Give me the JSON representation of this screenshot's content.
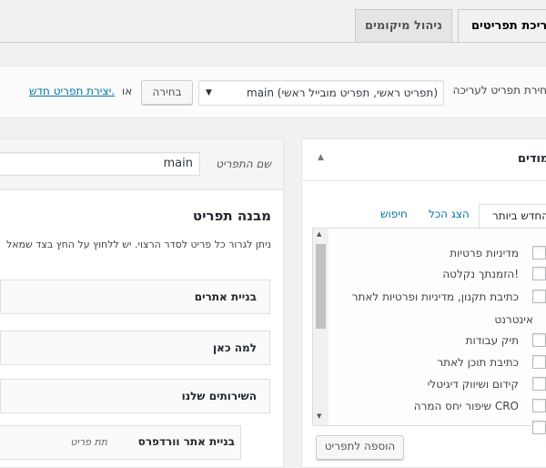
{
  "tabs": {
    "edit_menus": "עריכת תפריטים",
    "manage_locations": "ניהול מיקומים"
  },
  "manage_bar": {
    "select_label": "בחירת תפריט לעריכה:",
    "select_value": "main (תפריט ראשי, תפריט מובייל ראשי)",
    "select_button": "בחירה",
    "or_text": "או",
    "create_link": "יצירת תפריט חדש."
  },
  "left_panel": {
    "title": "עמודים",
    "tabs": [
      "החדש ביותר",
      "הצג הכל",
      "חיפוש"
    ],
    "items": [
      "מדיניות פרטיות",
      "הזמנתך נקלטה!",
      "כתיבת תקנון, מדיניות ופרטיות לאתר",
      "אינטרנט",
      "תיק עבודות",
      "כתיבת תוכן לאתר",
      "קידום ושיווק דיגיטלי",
      "שיפור יחס המרה CRO"
    ],
    "add_button": "הוספה לתפריט"
  },
  "menu_editor": {
    "name_label": "שם התפריט",
    "name_value": "main",
    "structure_title": "מבנה תפריט",
    "structure_hint": "ניתן לגרור כל פריט לסדר הרצוי. יש ללחוץ על החץ בצד שמאל",
    "items": [
      {
        "label": "בניית אתרים"
      },
      {
        "label": "למה כאן"
      },
      {
        "label": "השירותים שלנו"
      },
      {
        "label": "בניית אתר וורדפרס",
        "sub": "תת פריט"
      }
    ]
  }
}
